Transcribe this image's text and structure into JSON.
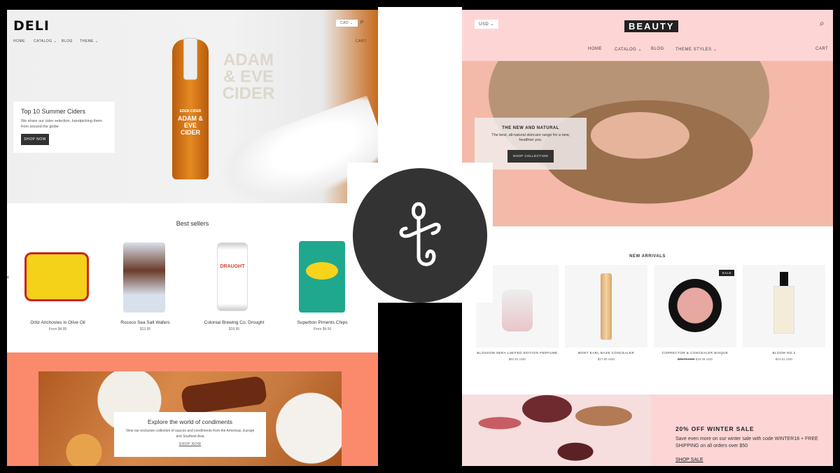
{
  "deli": {
    "logo": "DELI",
    "currency": "CAD",
    "nav": [
      "HOME",
      "CATALOG",
      "BLOG",
      "THEME"
    ],
    "cart": "CART",
    "hero": {
      "title": "Top 10 Summer Ciders",
      "text": "We share our cider selection, handpicking them from around the globe",
      "button": "SHOP NOW",
      "brand": "ADAM & EVE CIDER",
      "brand_top": "EDEN CIDER"
    },
    "best_sellers": {
      "title": "Best sellers",
      "products": [
        {
          "name": "Ortiz Anchovies in Olive Oil",
          "price": "From $4.95"
        },
        {
          "name": "Rococo Sea Salt Wafers",
          "price": "$12.95"
        },
        {
          "name": "Colonial Brewing Co. Drought",
          "price": "$19.95"
        },
        {
          "name": "Superbon Piments Chips",
          "price": "From $4.50"
        }
      ]
    },
    "promo": {
      "title": "Explore the world of condiments",
      "text": "View our exclusive collection of sauces and condiments from the Americas, Europe and Southest Asia",
      "link": "SHOP NOW"
    },
    "accent": "#fb8a6c"
  },
  "beauty": {
    "logo": "BEAUTY",
    "currency": "USD",
    "nav": [
      "HOME",
      "CATALOG",
      "BLOG",
      "THEME STYLES"
    ],
    "cart": "CART",
    "hero": {
      "title": "THE NEW AND NATURAL",
      "text": "The best, all-natural skincare range for a new, healthier you.",
      "button": "SHOP COLLECTION"
    },
    "new_arrivals": {
      "title": "NEW ARRIVALS",
      "sale_badge": "SALE",
      "products": [
        {
          "name": "BLOSSOM SERA LIMITED EDITION PERFUME",
          "price": "$81.81 USD"
        },
        {
          "name": "MONT EARL BASE CONCEALER",
          "price": "$17.80 USD"
        },
        {
          "name": "CORRECTOR & CONCEALER BISQUE",
          "old_price": "$23.74 USD",
          "price": "$19.29 USD"
        },
        {
          "name": "BLOOM NO.2",
          "price": "$44.51 USD"
        }
      ]
    },
    "promo": {
      "title": "20% OFF WINTER SALE",
      "text": "Save even more on our winter sale with code WINTER18 + FREE SHIPPING on all orders over $50",
      "link": "SHOP SALE"
    },
    "accent": "#fdd5d5"
  }
}
